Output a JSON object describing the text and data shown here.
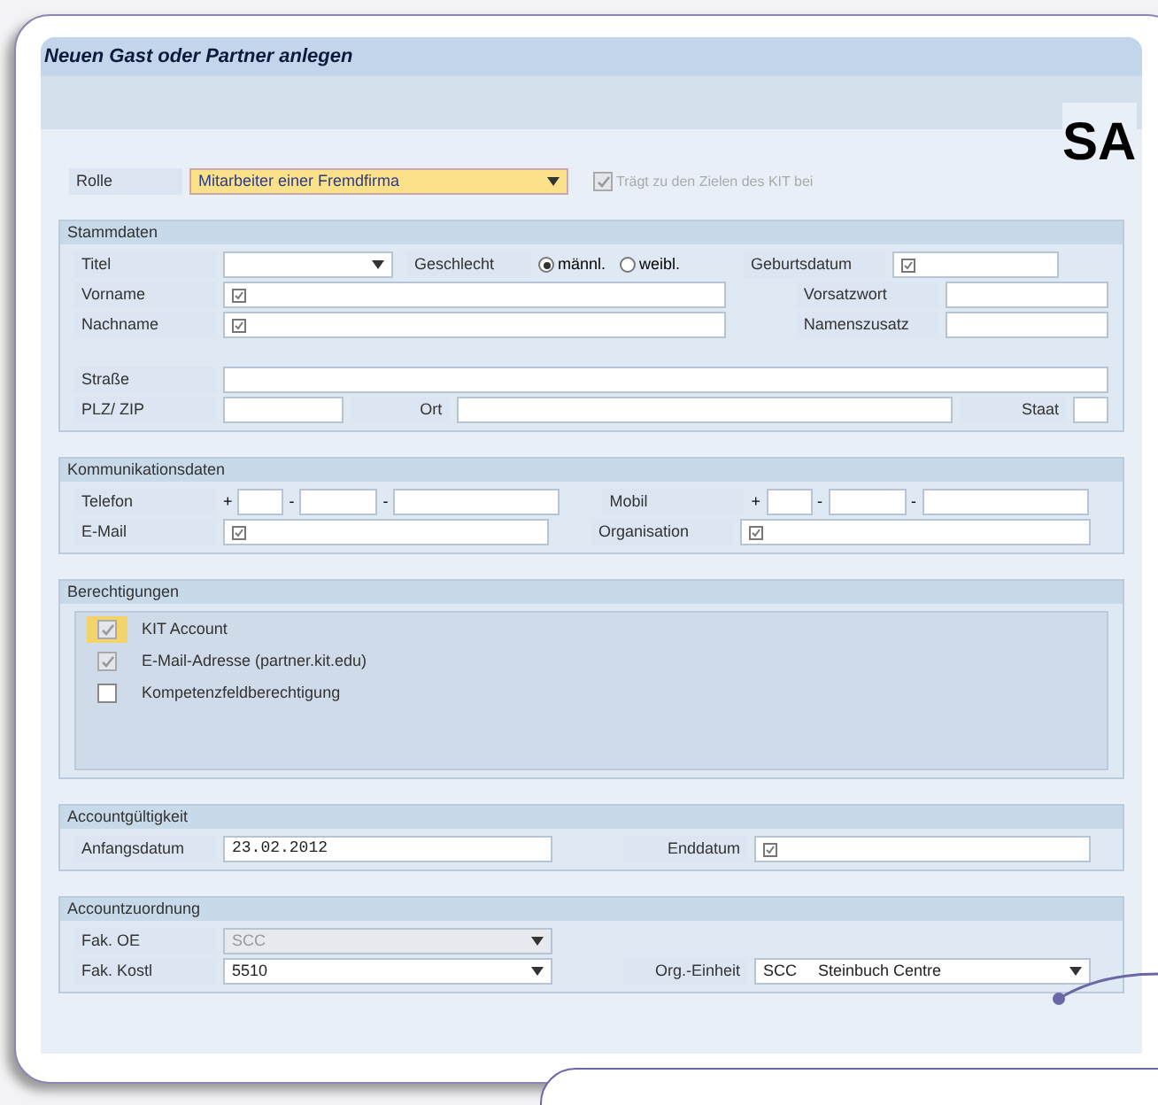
{
  "window": {
    "title": "Neuen Gast oder Partner anlegen"
  },
  "overlay_text": "SA",
  "rolle": {
    "label": "Rolle",
    "value": "Mitarbeiter einer Fremdfirma",
    "checkbox": {
      "label": "Trägt zu den Zielen des KIT bei",
      "checked": true,
      "disabled": true
    }
  },
  "stammdaten": {
    "title": "Stammdaten",
    "titel": {
      "label": "Titel"
    },
    "geschlecht": {
      "label": "Geschlecht",
      "options": [
        {
          "label": "männl.",
          "selected": true
        },
        {
          "label": "weibl.",
          "selected": false
        }
      ]
    },
    "geburtsdatum": {
      "label": "Geburtsdatum",
      "required": true
    },
    "vorname": {
      "label": "Vorname",
      "required": true
    },
    "vorsatzwort": {
      "label": "Vorsatzwort"
    },
    "nachname": {
      "label": "Nachname",
      "required": true
    },
    "namenszusatz": {
      "label": "Namenszusatz"
    },
    "strasse": {
      "label": "Straße"
    },
    "plz": {
      "label": "PLZ/ ZIP"
    },
    "ort": {
      "label": "Ort"
    },
    "staat": {
      "label": "Staat"
    }
  },
  "kommunikation": {
    "title": "Kommunikationsdaten",
    "telefon": {
      "label": "Telefon",
      "plus": "+",
      "sep": "-"
    },
    "mobil": {
      "label": "Mobil",
      "plus": "+",
      "sep": "-"
    },
    "email": {
      "label": "E-Mail",
      "required": true
    },
    "organisation": {
      "label": "Organisation",
      "required": true
    }
  },
  "berechtigungen": {
    "title": "Berechtigungen",
    "items": [
      {
        "label": "KIT Account",
        "checked": true,
        "disabled": true,
        "focused": true
      },
      {
        "label": "E-Mail-Adresse (partner.kit.edu)",
        "checked": true,
        "disabled": true,
        "focused": false
      },
      {
        "label": "Kompetenzfeldberechtigung",
        "checked": false,
        "disabled": false,
        "focused": false
      }
    ]
  },
  "gueltigkeit": {
    "title": "Accountgültigkeit",
    "anfang": {
      "label": "Anfangsdatum",
      "value": "23.02.2012"
    },
    "ende": {
      "label": "Enddatum",
      "required": true
    }
  },
  "zuordnung": {
    "title": "Accountzuordnung",
    "fak_oe": {
      "label": "Fak. OE",
      "value": "SCC",
      "disabled": true
    },
    "fak_kostl": {
      "label": "Fak. Kostl",
      "value": "5510",
      "disabled": false
    },
    "org": {
      "label": "Org.-Einheit",
      "code": "SCC",
      "value": "Steinbuch Centre",
      "disabled": false
    }
  }
}
